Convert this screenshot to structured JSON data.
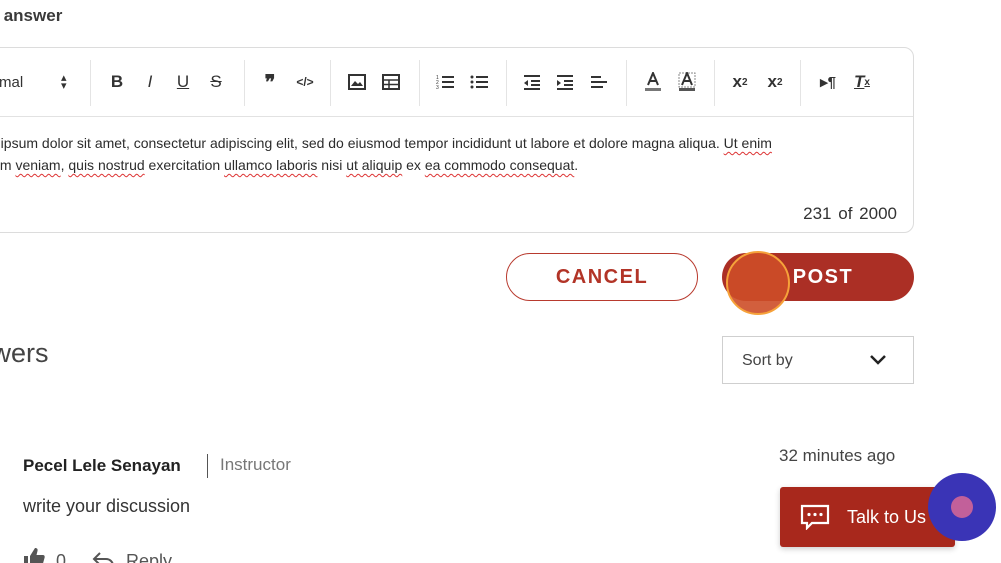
{
  "section": {
    "heading": "ur answer"
  },
  "editor": {
    "format_value": "mal",
    "toolbar": {
      "bold": "B",
      "italic": "I",
      "underline": "U",
      "strike": "S",
      "quote": "❞",
      "code": "</>",
      "subscript_base": "x",
      "subscript_mark": "2",
      "superscript_base": "x",
      "superscript_mark": "2",
      "direction": "▸¶",
      "clear_base": "T",
      "clear_mark": "x",
      "icons": [
        "bold-icon",
        "italic-icon",
        "underline-icon",
        "strikethrough-icon",
        "quote-icon",
        "code-icon",
        "image-icon",
        "table-icon",
        "ordered-list-icon",
        "bullet-list-icon",
        "outdent-icon",
        "indent-icon",
        "align-left-icon",
        "font-color-icon",
        "highlight-icon",
        "subscript-icon",
        "superscript-icon",
        "text-direction-icon",
        "clear-format-icon"
      ]
    },
    "text_line1_a": "n ipsum dolor sit amet, consectetur adipiscing elit, sed do eiusmod tempor incididunt ut labore et dolore magna aliqua. ",
    "text_line1_b": "Ut enim",
    "text_line2": [
      {
        "t": "nim ",
        "sq": false
      },
      {
        "t": "veniam",
        "sq": true
      },
      {
        "t": ", ",
        "sq": false
      },
      {
        "t": "quis nostrud",
        "sq": true
      },
      {
        "t": " exercitation ",
        "sq": false
      },
      {
        "t": "ullamco laboris",
        "sq": true
      },
      {
        "t": " nisi ",
        "sq": false
      },
      {
        "t": "ut aliquip",
        "sq": true
      },
      {
        "t": " ex ",
        "sq": false
      },
      {
        "t": "ea commodo consequat",
        "sq": true
      },
      {
        "t": ".",
        "sq": false
      }
    ],
    "counter_current": "231",
    "counter_of": "of",
    "counter_max": "2000"
  },
  "actions": {
    "cancel_label": "CANCEL",
    "post_label": "POST"
  },
  "answers": {
    "title": "swers",
    "sort_label": "Sort by",
    "items": [
      {
        "author": "Pecel Lele Senayan",
        "role": "Instructor",
        "time": "32 minutes ago",
        "text": "write your discussion",
        "likes": "0",
        "reply_label": "Reply"
      }
    ]
  },
  "chat": {
    "label": "Talk to Us"
  },
  "colors": {
    "brand_red": "#ab2f25",
    "widget_blue": "#3a34b6",
    "widget_dot": "#c2609a"
  }
}
